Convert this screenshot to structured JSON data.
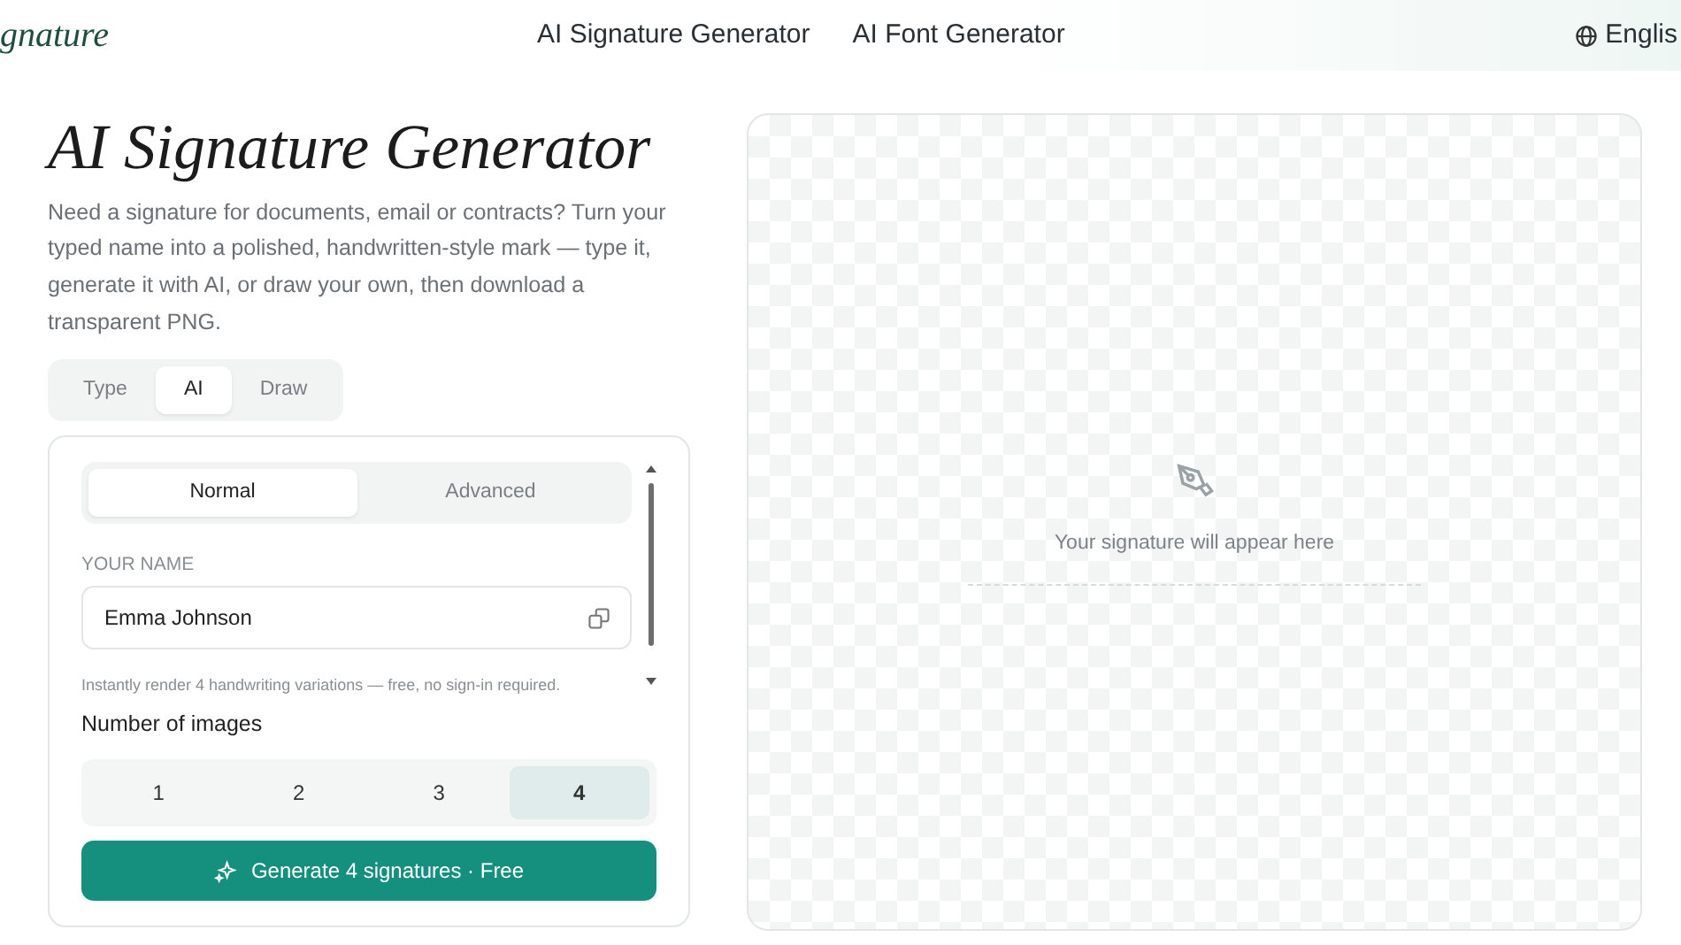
{
  "header": {
    "logo": "gnature",
    "nav": [
      "AI Signature Generator",
      "AI Font Generator"
    ],
    "language": "Englis"
  },
  "title": "AI Signature Generator",
  "intro": "Need a signature for documents, email or contracts? Turn your typed name into a polished, handwritten-style mark — type it, generate it with AI, or draw your own, then download a transparent PNG.",
  "tabs": [
    {
      "label": "Type",
      "selected": false
    },
    {
      "label": "AI",
      "selected": true
    },
    {
      "label": "Draw",
      "selected": false
    }
  ],
  "modes": [
    {
      "label": "Normal",
      "selected": true
    },
    {
      "label": "Advanced",
      "selected": false
    }
  ],
  "name_field": {
    "label": "YOUR NAME",
    "value": "Emma Johnson"
  },
  "hint": "Instantly render 4 handwriting variations — free, no sign-in required.",
  "count": {
    "label": "Number of images",
    "options": [
      {
        "label": "1",
        "selected": false
      },
      {
        "label": "2",
        "selected": false
      },
      {
        "label": "3",
        "selected": false
      },
      {
        "label": "4",
        "selected": true
      }
    ]
  },
  "generate_button": "Generate 4 signatures · Free",
  "preview": {
    "placeholder": "Your signature will appear here"
  }
}
